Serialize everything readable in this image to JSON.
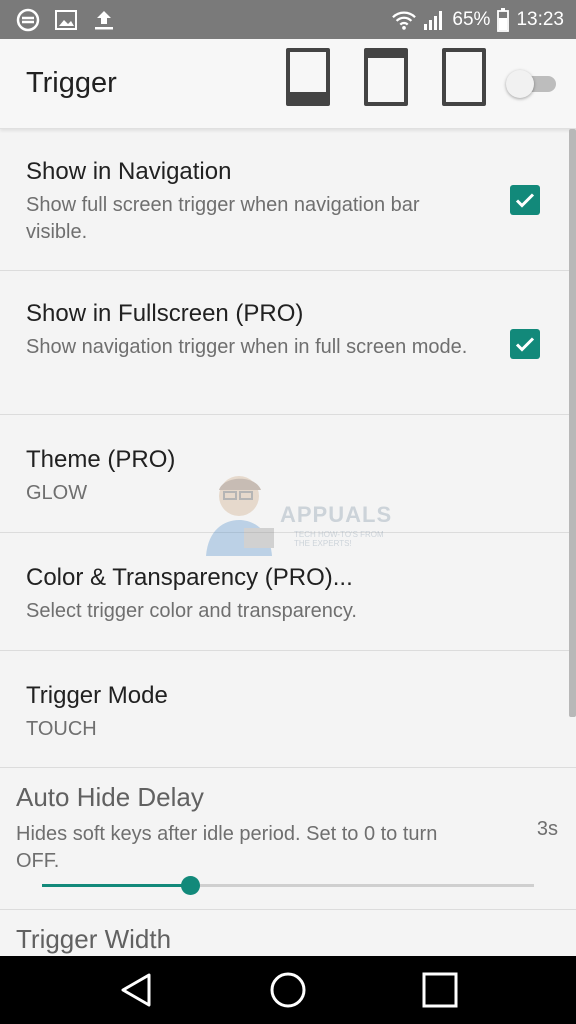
{
  "status_bar": {
    "icons_left": [
      "sync-icon",
      "image-icon",
      "upload-icon"
    ],
    "battery_percent": "65%",
    "time": "13:23"
  },
  "app_bar": {
    "title": "Trigger",
    "mode_icons": [
      "mode-navigation-icon",
      "mode-top-icon",
      "mode-none-icon"
    ],
    "toggle_on": false
  },
  "preferences": [
    {
      "title": "Show in Navigation",
      "summary": "Show full screen trigger when navigation bar visible.",
      "checked": true
    },
    {
      "title": "Show in Fullscreen (PRO)",
      "summary": "Show navigation trigger when in full screen mode.",
      "checked": true
    },
    {
      "title": "Theme (PRO)",
      "summary": "GLOW"
    },
    {
      "title": "Color & Transparency (PRO)...",
      "summary": "Select trigger color and transparency."
    },
    {
      "title": "Trigger Mode",
      "summary": "TOUCH"
    }
  ],
  "auto_hide": {
    "title": "Auto Hide Delay",
    "summary": "Hides soft keys after idle period. Set to 0 to turn OFF.",
    "value_label": "3s",
    "slider_fraction": 0.3
  },
  "trigger_width": {
    "title": "Trigger Width"
  },
  "watermark": {
    "text": "APPUALS",
    "sub": "TECH HOW-TO'S FROM THE EXPERTS!"
  },
  "colors": {
    "accent": "#12897a",
    "status_bar": "#7a7a7a",
    "nav_bar": "#000000"
  }
}
